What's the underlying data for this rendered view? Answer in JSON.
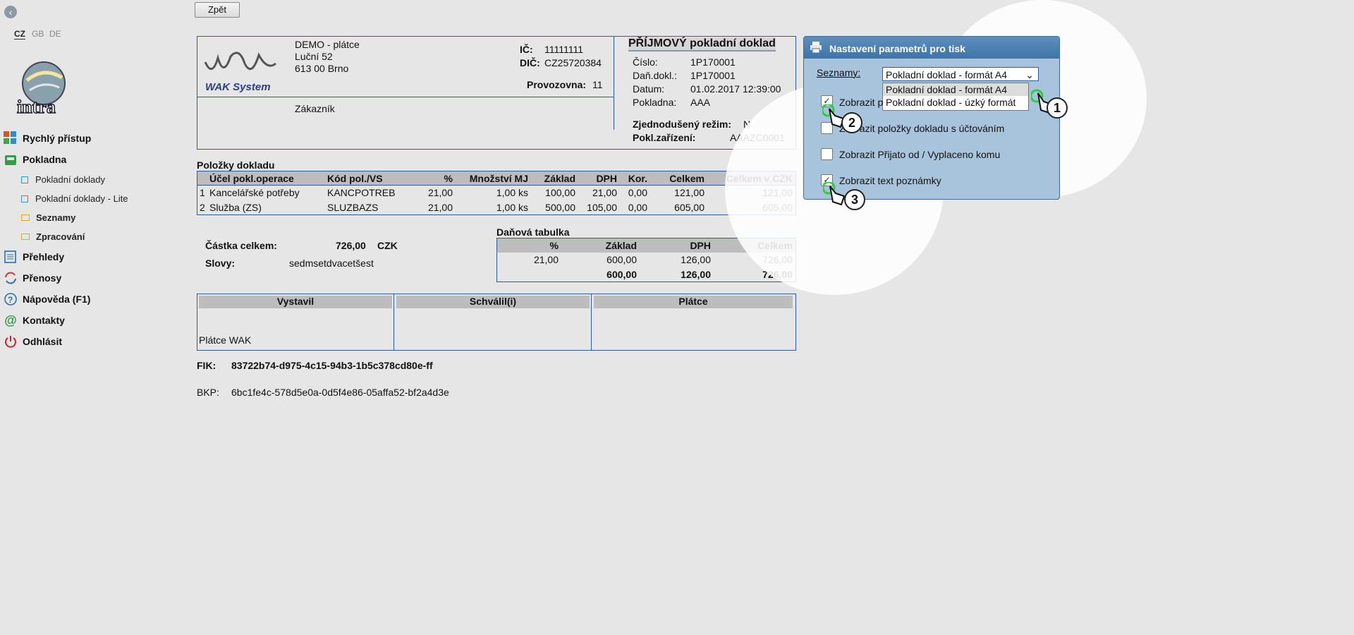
{
  "sidebar": {
    "languages": [
      "CZ",
      "GB",
      "DE"
    ],
    "logo_text": "intra",
    "menu": [
      {
        "label": "Rychlý přístup",
        "icon": "grid-icon"
      },
      {
        "label": "Pokladna",
        "icon": "cash-register-icon"
      },
      {
        "label": "Přehledy",
        "icon": "list-icon"
      },
      {
        "label": "Přenosy",
        "icon": "sync-icon"
      },
      {
        "label": "Nápověda (F1)",
        "icon": "help-icon"
      },
      {
        "label": "Kontakty",
        "icon": "at-icon"
      },
      {
        "label": "Odhlásit",
        "icon": "power-icon"
      }
    ],
    "submenu": [
      {
        "label": "Pokladní doklady"
      },
      {
        "label": "Pokladní doklady - Lite"
      },
      {
        "label": "Seznamy"
      },
      {
        "label": "Zpracování"
      }
    ]
  },
  "toolbar": {
    "back_label": "Zpět"
  },
  "document": {
    "company_logo_text": "WAK System",
    "company": {
      "name": "DEMO - plátce",
      "street": "Luční 52",
      "city": "613 00 Brno",
      "customer_label": "Zákazník"
    },
    "ic_label": "IČ:",
    "ic": "11111111",
    "dic_label": "DIČ:",
    "dic": "CZ25720384",
    "branch_label": "Provozovna:",
    "branch": "11",
    "title": "PŘÍJMOVÝ pokladní doklad",
    "meta": [
      {
        "label": "Číslo:",
        "value": "1P170001"
      },
      {
        "label": "Daň.dokl.:",
        "value": "1P170001"
      },
      {
        "label": "Datum:",
        "value": "01.02.2017 12:39:00"
      },
      {
        "label": "Pokladna:",
        "value": "AAA"
      }
    ],
    "simplified_label": "Zjednodušený režim:",
    "simplified": "N",
    "device_label": "Pokl.zařízení:",
    "device": "AAAZC0001",
    "items_title": "Položky dokladu",
    "items_headers": [
      "Účel pokl.operace",
      "Kód pol./VS",
      "%",
      "Množství MJ",
      "Základ",
      "DPH",
      "Kor.",
      "Celkem",
      "Celkem v CZK"
    ],
    "items": [
      {
        "n": "1",
        "purpose": "Kancelářské potřeby",
        "code": "KANCPOTREB",
        "pct": "21,00",
        "qty": "1,00 ks",
        "base": "100,00",
        "vat": "21,00",
        "kor": "0,00",
        "total": "121,00",
        "total_czk": "121,00"
      },
      {
        "n": "2",
        "purpose": "Služba (ZS)",
        "code": "SLUZBAZS",
        "pct": "21,00",
        "qty": "1,00 ks",
        "base": "500,00",
        "vat": "105,00",
        "kor": "0,00",
        "total": "605,00",
        "total_czk": "605,00"
      }
    ],
    "amount_label": "Částka celkem:",
    "amount": "726,00",
    "currency": "CZK",
    "words_label": "Slovy:",
    "words": "sedmsetdvacetšest",
    "tax_title": "Daňová tabulka",
    "tax_headers": [
      "%",
      "Základ",
      "DPH",
      "Celkem"
    ],
    "tax_row": {
      "pct": "21,00",
      "base": "600,00",
      "vat": "126,00",
      "total": "726,00"
    },
    "tax_sum": {
      "base": "600,00",
      "vat": "126,00",
      "total": "726,00"
    },
    "sign_headers": [
      "Vystavil",
      "Schválil(i)",
      "Plátce"
    ],
    "issuer": "Plátce WAK",
    "fik_label": "FIK:",
    "fik": "83722b74-d975-4c15-94b3-1b5c378cd80e-ff",
    "bkp_label": "BKP:",
    "bkp": "6bc1fe4c-578d5e0a-0d5f4e86-05affa52-bf2a4d3e"
  },
  "print_panel": {
    "title": "Nastavení parametrů pro tisk",
    "lists_label": "Seznamy:",
    "selected": "Pokladní doklad - formát A4",
    "options": [
      "Pokladní doklad - formát A4",
      "Pokladní doklad - úzký formát"
    ],
    "checkboxes": [
      {
        "label": "Zobrazit p",
        "checked": true
      },
      {
        "label": "Zobrazit položky dokladu s účtováním",
        "checked": false
      },
      {
        "label": "Zobrazit Přijato od / Vyplaceno komu",
        "checked": false
      },
      {
        "label": "Zobrazit text poznámky",
        "checked": true
      }
    ],
    "callouts": [
      "1",
      "2",
      "3"
    ]
  }
}
